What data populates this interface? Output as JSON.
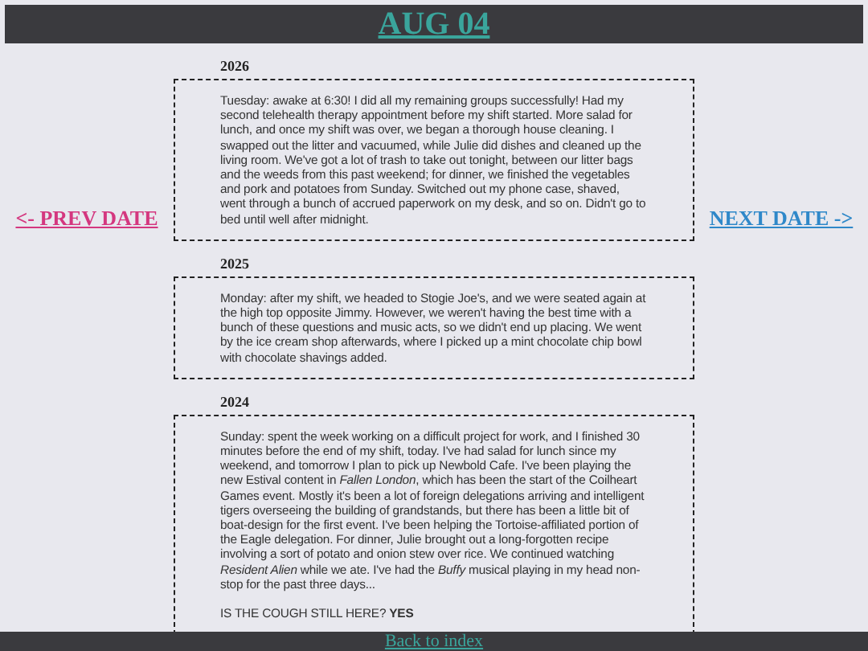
{
  "title": "AUG 04",
  "prev_link": "<- PREV DATE",
  "next_link": "NEXT DATE ->",
  "entries": [
    {
      "year": "2026",
      "paragraphs": [
        "Tuesday: awake at 6:30! I did all my remaining groups successfully! Had my second telehealth therapy appointment before my shift started. More salad for lunch, and once my shift was over, we began a thorough house cleaning. I swapped out the litter and vacuumed, while Julie did dishes and cleaned up the living room. We've got a lot of trash to take out tonight, between our litter bags and the weeds from this past weekend; for dinner, we finished the vegetables and pork and potatoes from Sunday. Switched out my phone case, shaved, went through a bunch of accrued paperwork on my desk, and so on. Didn't go to bed until well after midnight."
      ]
    },
    {
      "year": "2025",
      "paragraphs": [
        "Monday: after my shift, we headed to Stogie Joe's, and we were seated again at the high top opposite Jimmy. However, we weren't having the best time with a bunch of these questions and music acts, so we didn't end up placing. We went by the ice cream shop afterwards, where I picked up a mint chocolate chip bowl with chocolate shavings added."
      ]
    },
    {
      "year": "2024",
      "paragraphs": [
        "Sunday: spent the week working on a difficult project for work, and I finished 30 minutes before the end of my shift, today. I've had salad for lunch since my weekend, and tomorrow I plan to pick up Newbold Cafe. I've been playing the new Estival content in *Fallen London*, which has been the start of the Coilheart Games event. Mostly it's been a lot of foreign delegations arriving and intelligent tigers overseeing the building of grandstands, but there has been a little bit of boat-design for the first event. I've been helping the Tortoise-affiliated portion of the Eagle delegation. For dinner, Julie brought out a long-forgotten recipe involving a sort of potato and onion stew over rice. We continued watching *Resident Alien* while we ate. I've had the *Buffy* musical playing in my head non-stop for the past three days...",
        "IS THE COUGH STILL HERE? **YES**"
      ]
    }
  ],
  "footer_link": "Back to index"
}
